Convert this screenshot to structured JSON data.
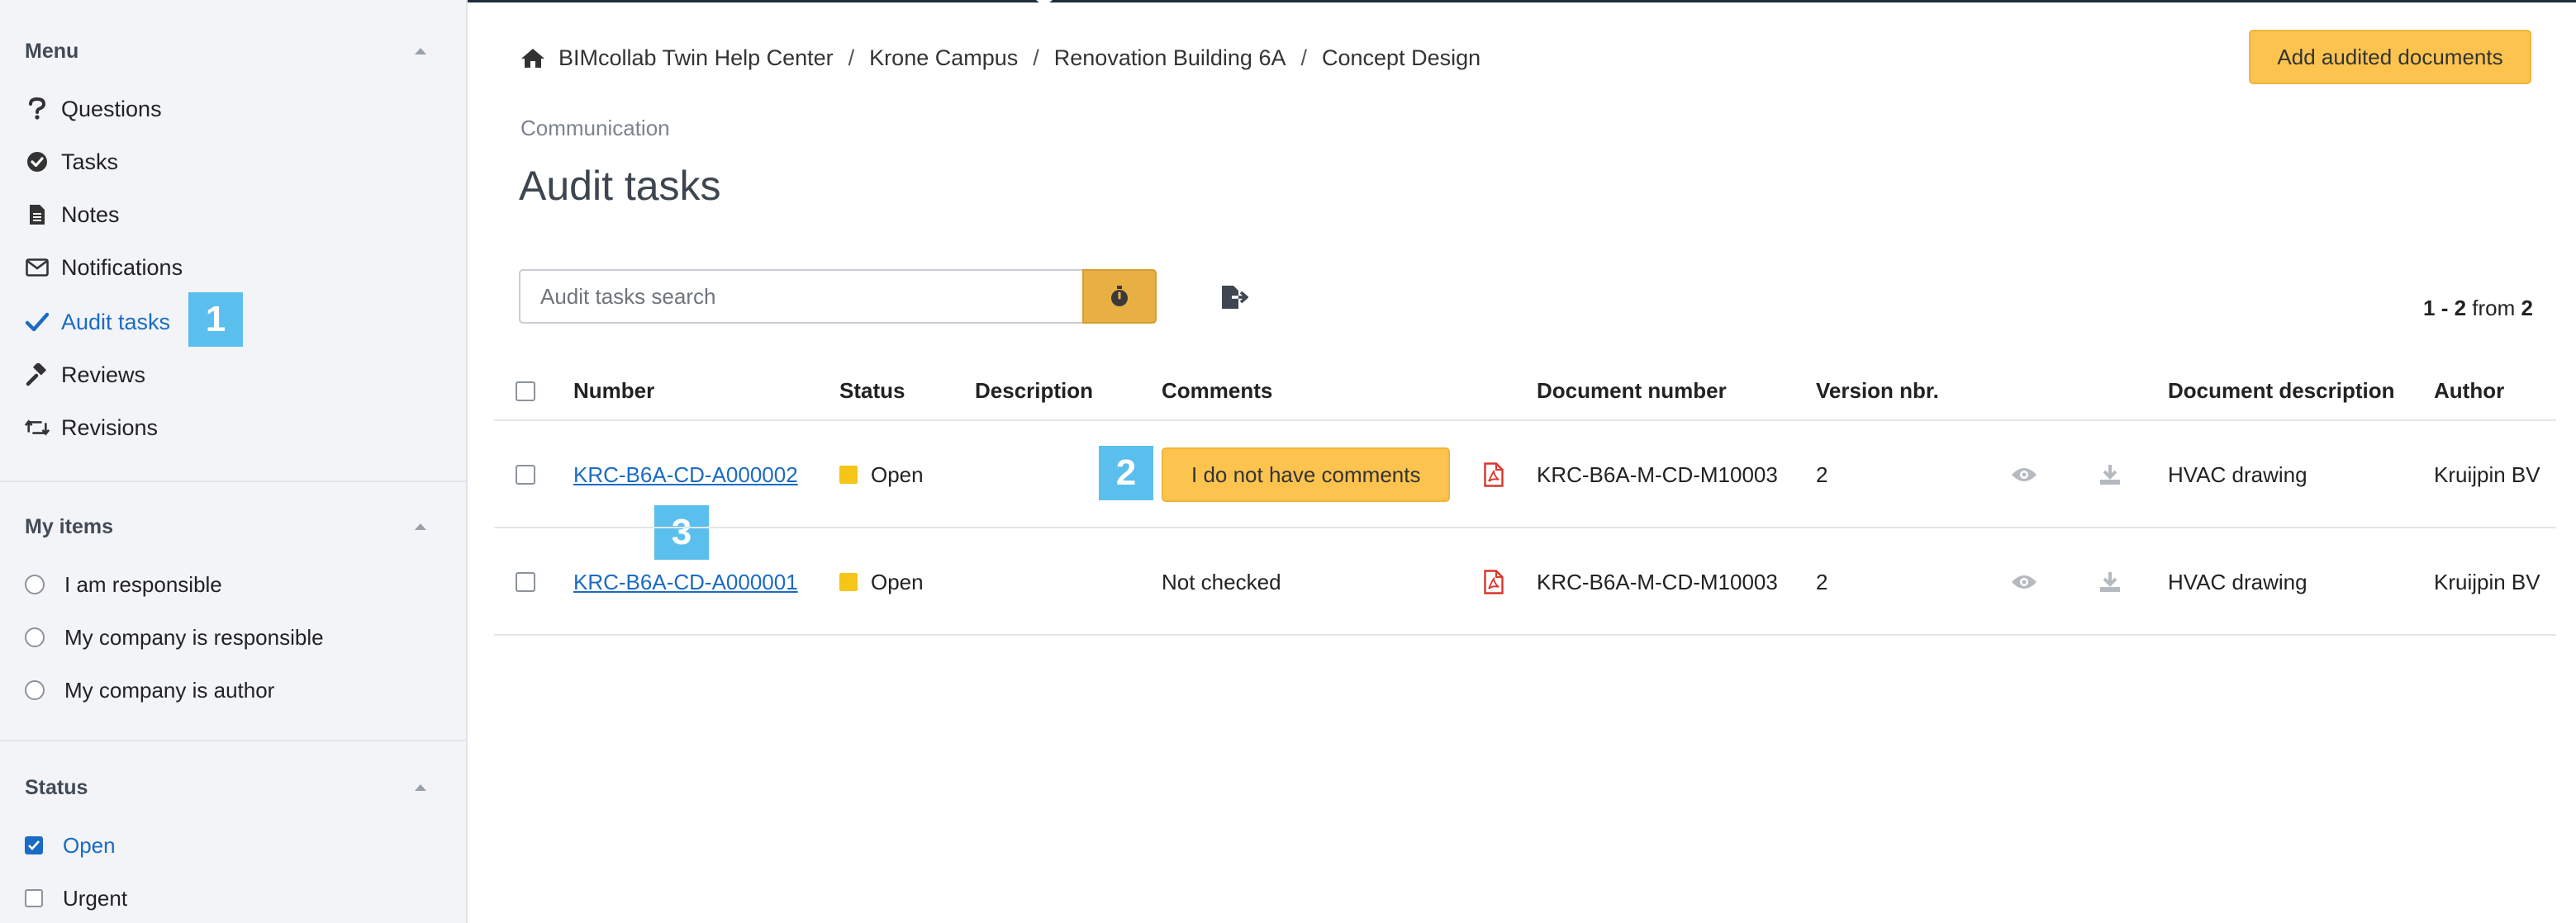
{
  "sidebar": {
    "menu": {
      "title": "Menu",
      "items": [
        {
          "label": "Questions",
          "icon": "question-icon"
        },
        {
          "label": "Tasks",
          "icon": "check-circle-icon"
        },
        {
          "label": "Notes",
          "icon": "document-icon"
        },
        {
          "label": "Notifications",
          "icon": "envelope-icon"
        },
        {
          "label": "Audit tasks",
          "icon": "checkmark-icon",
          "active": true
        },
        {
          "label": "Reviews",
          "icon": "gavel-icon"
        },
        {
          "label": "Revisions",
          "icon": "retweet-icon"
        }
      ]
    },
    "my_items": {
      "title": "My items",
      "options": [
        "I am responsible",
        "My company is responsible",
        "My company is author"
      ]
    },
    "status": {
      "title": "Status",
      "options": [
        {
          "label": "Open",
          "checked": true
        },
        {
          "label": "Urgent",
          "checked": false
        }
      ]
    }
  },
  "callouts": {
    "one": "1",
    "two": "2",
    "three": "3"
  },
  "breadcrumb": [
    "BIMcollab Twin Help Center",
    "Krone Campus",
    "Renovation Building 6A",
    "Concept Design"
  ],
  "breadcrumb_separator": "/",
  "header": {
    "add_button": "Add audited documents",
    "section": "Communication",
    "title": "Audit tasks"
  },
  "search": {
    "placeholder": "Audit tasks search"
  },
  "pager": {
    "range": "1 - 2",
    "from_word": "from",
    "total": "2"
  },
  "table": {
    "headers": {
      "number": "Number",
      "status": "Status",
      "description": "Description",
      "comments": "Comments",
      "document_number": "Document number",
      "version": "Version nbr.",
      "document_description": "Document description",
      "author": "Author"
    },
    "rows": [
      {
        "number": "KRC-B6A-CD-A000002",
        "status": "Open",
        "description": "",
        "comments": "I do not have comments",
        "comments_is_button": true,
        "document_number": "KRC-B6A-M-CD-M10003",
        "version": "2",
        "document_description": "HVAC drawing",
        "author": "Kruijpin BV"
      },
      {
        "number": "KRC-B6A-CD-A000001",
        "status": "Open",
        "description": "",
        "comments": "Not checked",
        "comments_is_button": false,
        "document_number": "KRC-B6A-M-CD-M10003",
        "version": "2",
        "document_description": "HVAC drawing",
        "author": "Kruijpin BV"
      }
    ]
  },
  "colors": {
    "accent": "#1a6bc4",
    "primary_button": "#fcc44f",
    "search_button": "#e8b044",
    "status_open": "#f5c518",
    "callout": "#5bbfee",
    "pdf_icon": "#d9362c"
  }
}
